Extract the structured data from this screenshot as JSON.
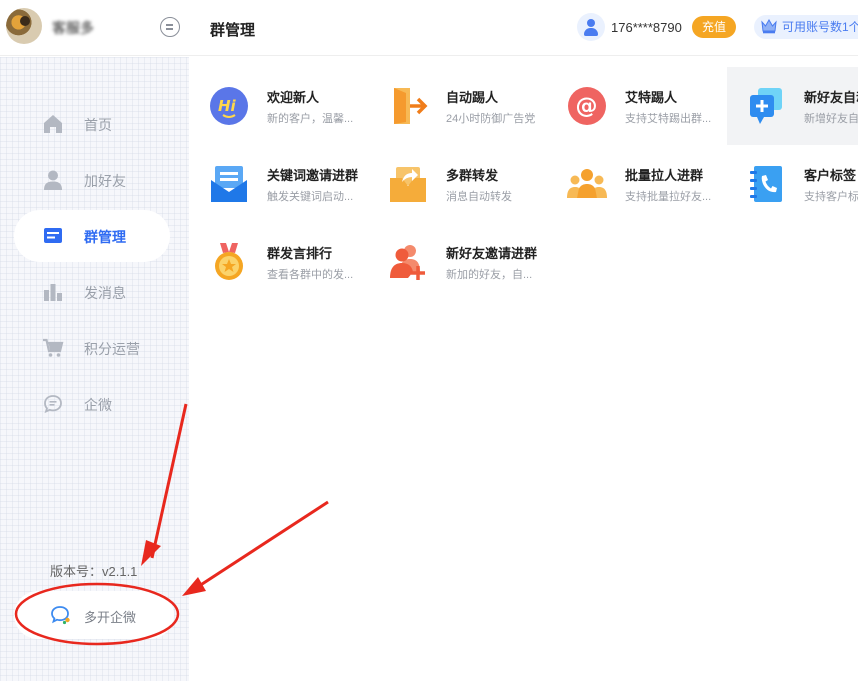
{
  "header": {
    "username": "客服多",
    "title": "群管理",
    "phone": "176****8790",
    "recharge_label": "充值",
    "accounts_label": "可用账号数1个"
  },
  "sidebar": {
    "items": [
      {
        "label": "首页",
        "icon": "home-icon"
      },
      {
        "label": "加好友",
        "icon": "person-icon"
      },
      {
        "label": "群管理",
        "icon": "group-manage-icon",
        "active": true
      },
      {
        "label": "发消息",
        "icon": "bar-chart-icon"
      },
      {
        "label": "积分运营",
        "icon": "cart-icon"
      },
      {
        "label": "企微",
        "icon": "chat-bubble-icon"
      }
    ],
    "version": "版本号：v2.1.1",
    "multi_open_label": "多开企微"
  },
  "features": [
    {
      "title": "欢迎新人",
      "desc": "新的客户，温馨...",
      "icon": "hi-icon"
    },
    {
      "title": "自动踢人",
      "desc": "24小时防御广告党",
      "icon": "exit-door-icon"
    },
    {
      "title": "艾特踢人",
      "desc": "支持艾特踢出群...",
      "icon": "at-icon"
    },
    {
      "title": "新好友自动",
      "desc": "新增好友自",
      "icon": "add-friend-card-icon"
    },
    {
      "title": "关键词邀请进群",
      "desc": "触发关键词启动...",
      "icon": "envelope-icon"
    },
    {
      "title": "多群转发",
      "desc": "消息自动转发",
      "icon": "forward-folder-icon"
    },
    {
      "title": "批量拉人进群",
      "desc": "支持批量拉好友...",
      "icon": "people-group-icon"
    },
    {
      "title": "客户标签",
      "desc": "支持客户标",
      "icon": "phone-book-icon"
    },
    {
      "title": "群发言排行",
      "desc": "查看各群中的发...",
      "icon": "medal-icon"
    },
    {
      "title": "新好友邀请进群",
      "desc": "新加的好友，自...",
      "icon": "invite-person-icon"
    }
  ],
  "colors": {
    "accent": "#2f6bf2",
    "recharge": "#f5a623",
    "annotation": "#e8281e"
  }
}
